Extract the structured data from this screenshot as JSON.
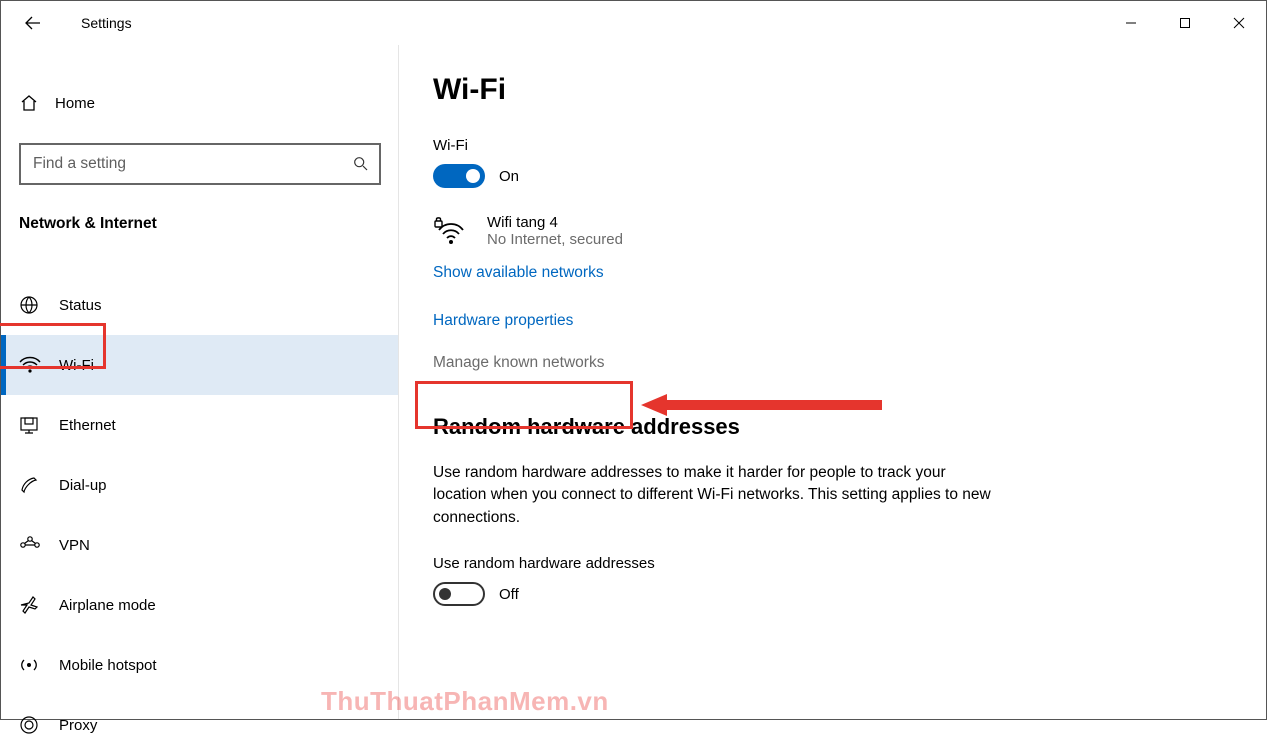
{
  "window": {
    "title": "Settings"
  },
  "sidebar": {
    "home": "Home",
    "search_placeholder": "Find a setting",
    "section": "Network & Internet",
    "items": [
      {
        "label": "Status"
      },
      {
        "label": "Wi-Fi"
      },
      {
        "label": "Ethernet"
      },
      {
        "label": "Dial-up"
      },
      {
        "label": "VPN"
      },
      {
        "label": "Airplane mode"
      },
      {
        "label": "Mobile hotspot"
      },
      {
        "label": "Proxy"
      }
    ]
  },
  "main": {
    "title": "Wi-Fi",
    "wifi_label": "Wi-Fi",
    "wifi_state": "On",
    "network": {
      "name": "Wifi tang 4",
      "status": "No Internet, secured"
    },
    "links": {
      "show_networks": "Show available networks",
      "hw_props": "Hardware properties",
      "manage_known": "Manage known networks"
    },
    "random": {
      "heading": "Random hardware addresses",
      "desc": "Use random hardware addresses to make it harder for people to track your location when you connect to different Wi-Fi networks. This setting applies to new connections.",
      "toggle_label": "Use random hardware addresses",
      "toggle_state": "Off"
    }
  },
  "watermark": "ThuThuatPhanMem.vn"
}
